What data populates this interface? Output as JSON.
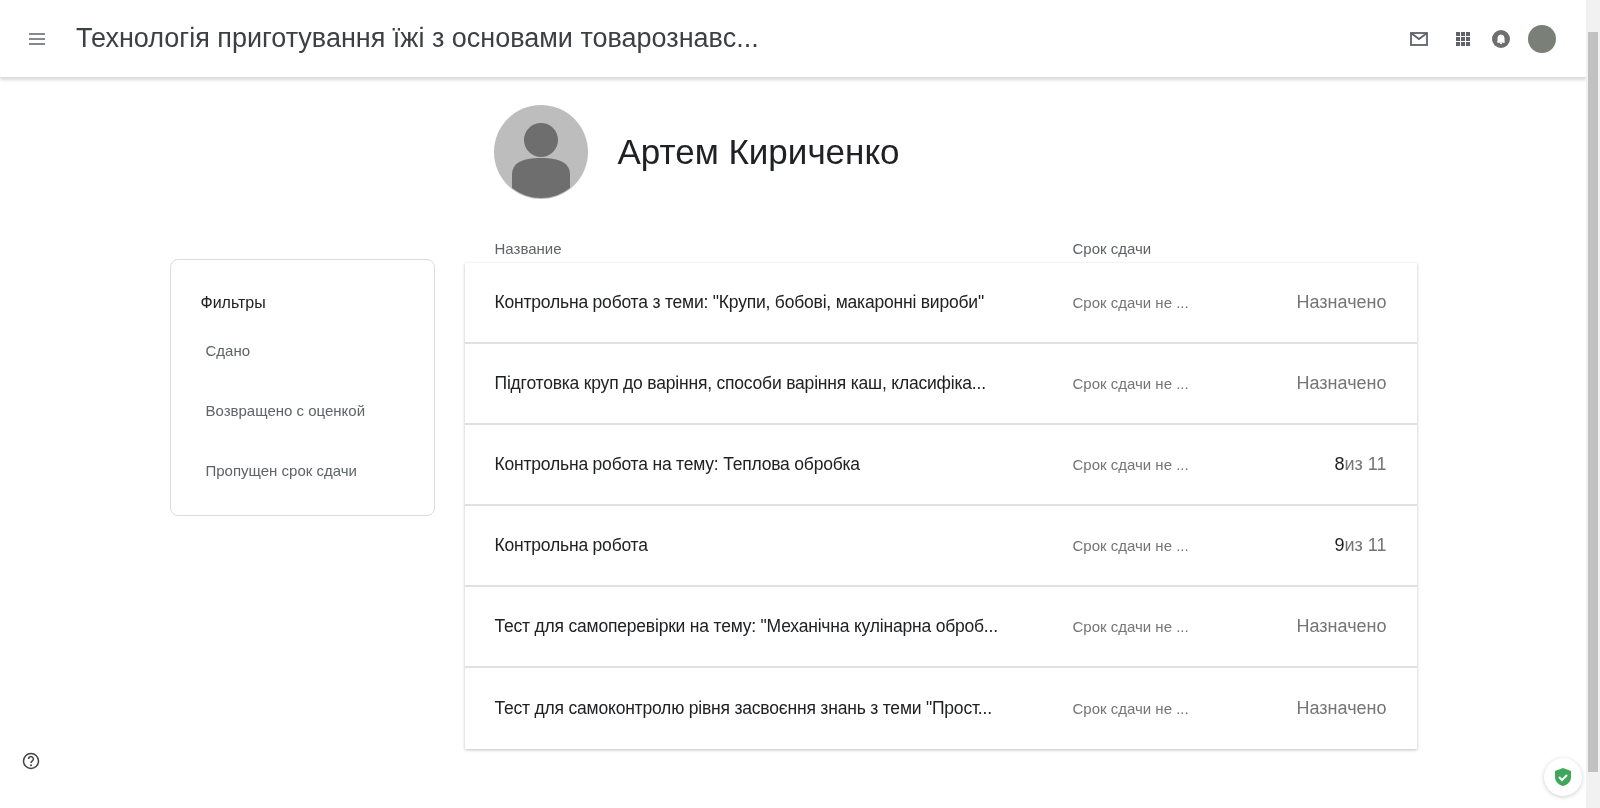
{
  "header": {
    "title": "Технологія приготування їжі з основами товарознавс..."
  },
  "student": {
    "name": "Артем Кириченко"
  },
  "filters": {
    "title": "Фильтры",
    "items": [
      {
        "label": "Сдано"
      },
      {
        "label": "Возвращено с оценкой"
      },
      {
        "label": "Пропущен срок сдачи"
      }
    ]
  },
  "table": {
    "columns": [
      "Название",
      "Срок сдачи"
    ],
    "rows": [
      {
        "title": "Контрольна робота з теми: \"Крупи, бобові, макаронні вироби\"",
        "due": "Срок сдачи не ...",
        "kind": "status",
        "status": "Назначено"
      },
      {
        "title": "Підготовка круп до варіння, способи варіння каш, класифіка...",
        "due": "Срок сдачи не ...",
        "kind": "status",
        "status": "Назначено"
      },
      {
        "title": "Контрольна робота на тему: Теплова обробка",
        "due": "Срок сдачи не ...",
        "kind": "grade",
        "score": "8",
        "total": "из 11"
      },
      {
        "title": "Контрольна робота",
        "due": "Срок сдачи не ...",
        "kind": "grade",
        "score": "9",
        "total": "из 11"
      },
      {
        "title": "Тест для самоперевірки на тему: \"Механічна кулінарна оброб...",
        "due": "Срок сдачи не ...",
        "kind": "status",
        "status": "Назначено"
      },
      {
        "title": "Тест для самоконтролю рівня засвоєння знань з теми \"Прост...",
        "due": "Срок сдачи не ...",
        "kind": "status",
        "status": "Назначено"
      }
    ]
  }
}
